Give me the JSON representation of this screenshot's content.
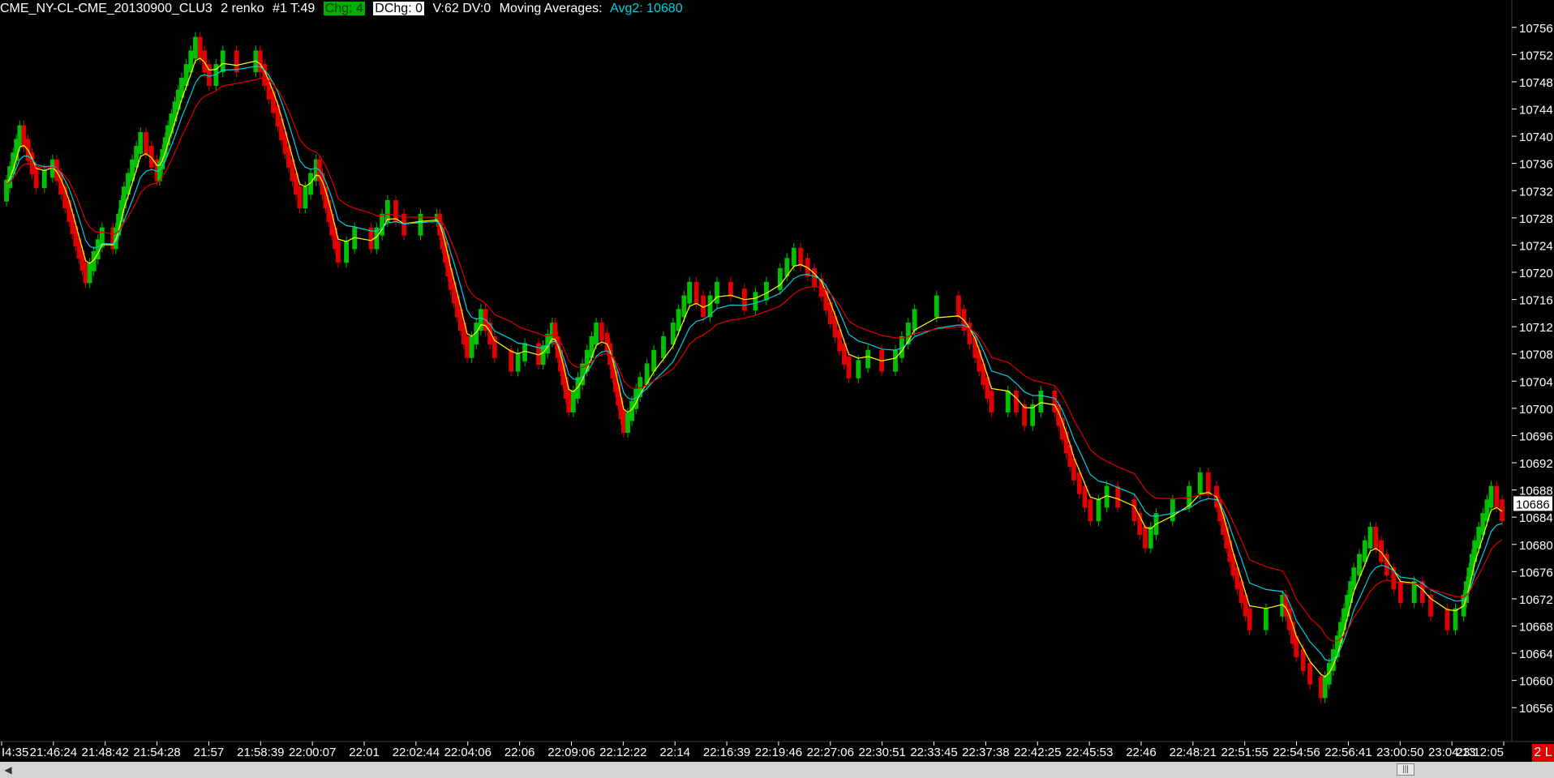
{
  "header": {
    "symbol": "CME_NY-CL-CME_20130900_CLU3",
    "bar_type": "2 renko",
    "tick_info": "#1 T:49",
    "chg": "Chg: 4",
    "dchg": "DChg: 0",
    "volume": "V:62 DV:0",
    "ma_label": "Moving Averages:",
    "avg2": "Avg2: 10680"
  },
  "status_badge": "2 L",
  "scrollbar": {
    "left_arrow": "◀",
    "thumb": "|||"
  },
  "colors": {
    "background": "#000000",
    "up_bar": "#00c000",
    "down_bar": "#e00000",
    "ma_fast": "#ffff00",
    "ma_mid": "#00d0e0",
    "ma_slow": "#e00000",
    "last_price_box": "#ffffff"
  },
  "chart_data": {
    "type": "line",
    "title": "",
    "x_tick_labels": [
      "I4:35",
      "21:46:24",
      "21:48:42",
      "21:54:28",
      "21:57",
      "21:58:39",
      "22:00:07",
      "22:01",
      "22:02:44",
      "22:04:06",
      "22:06",
      "22:09:06",
      "22:12:22",
      "22:14",
      "22:16:39",
      "22:19:46",
      "22:27:06",
      "22:30:51",
      "22:33:45",
      "22:37:38",
      "22:42:25",
      "22:45:53",
      "22:46",
      "22:48:21",
      "22:51:55",
      "22:54:56",
      "22:56:41",
      "23:00:50",
      "23:04:13",
      "23:12:05"
    ],
    "y_ticks": [
      10756,
      10752,
      10748,
      10744,
      10740,
      10736,
      10732,
      10728,
      10724,
      10720,
      10716,
      10712,
      10708,
      10704,
      10700,
      10696,
      10692,
      10688,
      10684,
      10680,
      10676,
      10672,
      10668,
      10664,
      10660,
      10656
    ],
    "ylim": [
      10654,
      10758
    ],
    "last_price": "10686",
    "brick_size": 2,
    "price_path": [
      [
        0,
        10731
      ],
      [
        0.6,
        10741
      ],
      [
        1.2,
        10733
      ],
      [
        1.8,
        10736
      ],
      [
        2.4,
        10728
      ],
      [
        3.0,
        10719
      ],
      [
        3.6,
        10726
      ],
      [
        4.0,
        10724
      ],
      [
        4.4,
        10732
      ],
      [
        5.0,
        10740
      ],
      [
        5.6,
        10734
      ],
      [
        6.0,
        10741
      ],
      [
        6.5,
        10748
      ],
      [
        7.0,
        10754
      ],
      [
        7.5,
        10748
      ],
      [
        8.0,
        10752
      ],
      [
        8.5,
        10750
      ],
      [
        9.2,
        10752
      ],
      [
        10.0,
        10742
      ],
      [
        10.8,
        10730
      ],
      [
        11.4,
        10736
      ],
      [
        12.2,
        10722
      ],
      [
        12.8,
        10726
      ],
      [
        13.4,
        10724
      ],
      [
        14.0,
        10730
      ],
      [
        14.6,
        10726
      ],
      [
        15.2,
        10728
      ],
      [
        15.8,
        10728
      ],
      [
        16.3,
        10718
      ],
      [
        16.9,
        10708
      ],
      [
        17.4,
        10714
      ],
      [
        17.9,
        10708
      ],
      [
        18.5,
        10706
      ],
      [
        19.0,
        10709
      ],
      [
        19.5,
        10707
      ],
      [
        20.0,
        10712
      ],
      [
        20.6,
        10700
      ],
      [
        21.1,
        10706
      ],
      [
        21.6,
        10712
      ],
      [
        22.0,
        10709
      ],
      [
        22.6,
        10697
      ],
      [
        23.2,
        10704
      ],
      [
        23.7,
        10708
      ],
      [
        24.4,
        10712
      ],
      [
        25.0,
        10718
      ],
      [
        25.5,
        10714
      ],
      [
        26.0,
        10718
      ],
      [
        26.5,
        10717
      ],
      [
        27.0,
        10715
      ],
      [
        27.8,
        10718
      ],
      [
        28.3,
        10720
      ],
      [
        28.8,
        10723
      ],
      [
        29.3,
        10720
      ],
      [
        29.8,
        10717
      ],
      [
        30.3,
        10711
      ],
      [
        30.8,
        10705
      ],
      [
        31.5,
        10708
      ],
      [
        32.0,
        10706
      ],
      [
        32.5,
        10708
      ],
      [
        33.2,
        10714
      ],
      [
        34.0,
        10716
      ],
      [
        34.8,
        10714
      ],
      [
        35.4,
        10708
      ],
      [
        36.0,
        10700
      ],
      [
        36.6,
        10702
      ],
      [
        37.2,
        10698
      ],
      [
        37.8,
        10702
      ],
      [
        38.3,
        10700
      ],
      [
        39.0,
        10690
      ],
      [
        39.6,
        10684
      ],
      [
        40.2,
        10688
      ],
      [
        40.6,
        10686
      ],
      [
        41.2,
        10684
      ],
      [
        41.6,
        10680
      ],
      [
        42.0,
        10684
      ],
      [
        42.6,
        10686
      ],
      [
        43.2,
        10688
      ],
      [
        43.6,
        10690
      ],
      [
        44.2,
        10686
      ],
      [
        44.8,
        10676
      ],
      [
        45.4,
        10668
      ],
      [
        46.0,
        10670
      ],
      [
        46.6,
        10672
      ],
      [
        47.1,
        10664
      ],
      [
        47.6,
        10660
      ],
      [
        48.0,
        10658
      ],
      [
        48.6,
        10666
      ],
      [
        49.2,
        10676
      ],
      [
        49.8,
        10682
      ],
      [
        50.4,
        10676
      ],
      [
        50.9,
        10672
      ],
      [
        51.4,
        10674
      ],
      [
        52.0,
        10670
      ],
      [
        52.6,
        10668
      ],
      [
        53.2,
        10672
      ],
      [
        53.6,
        10680
      ],
      [
        54.2,
        10688
      ],
      [
        54.6,
        10684
      ]
    ],
    "moving_averages": [
      {
        "name": "Avg2",
        "value": 10680
      }
    ]
  }
}
